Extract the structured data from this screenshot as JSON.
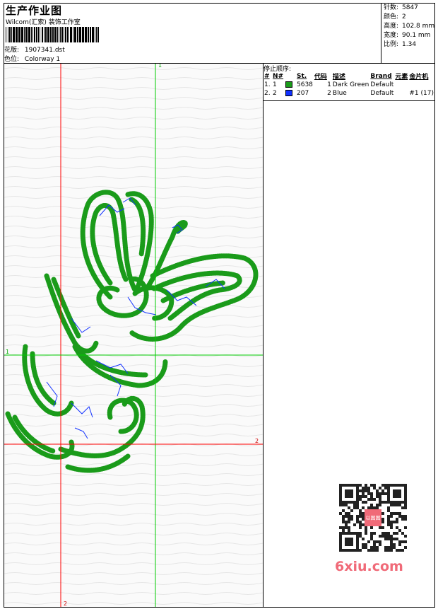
{
  "header": {
    "title": "生产作业图",
    "company": "Wilcom(汇索) 装饰工作室",
    "design_label": "花版:",
    "design_value": "1907341.dst",
    "colorway_label": "色位:",
    "colorway_value": "Colorway 1"
  },
  "stats": [
    {
      "label": "针数:",
      "value": "5847"
    },
    {
      "label": "颜色:",
      "value": "2"
    },
    {
      "label": "高度:",
      "value": "102.8 mm"
    },
    {
      "label": "宽度:",
      "value": "90.1 mm"
    },
    {
      "label": "比例:",
      "value": "1.34"
    }
  ],
  "stop_sequence": {
    "title": "停止顺序:",
    "columns": [
      "#",
      "N#",
      "St.",
      "代码",
      "描述",
      "Brand",
      "元素",
      "金片机"
    ],
    "rows": [
      {
        "idx": "1.",
        "n": "1",
        "color": "#1a9b1a",
        "st": "5638",
        "code": "1",
        "desc": "Dark Green",
        "brand": "Default",
        "element": "",
        "sequin": ""
      },
      {
        "idx": "2.",
        "n": "2",
        "color": "#1030ff",
        "st": "207",
        "code": "2",
        "desc": "Blue",
        "brand": "Default",
        "element": "",
        "sequin": "#1 (17)"
      }
    ]
  },
  "guides": {
    "top_label": "1",
    "left_label": "1",
    "right_label": "2",
    "bottom_label": "2"
  },
  "colors": {
    "thread_green": "#1a9b1a",
    "thread_blue": "#1030ff",
    "guide_red": "#ff0000",
    "guide_green": "#00cc00",
    "watermark": "#f06a78"
  },
  "watermark": {
    "text": "6xiu.com",
    "qr_badge": "以图图"
  }
}
